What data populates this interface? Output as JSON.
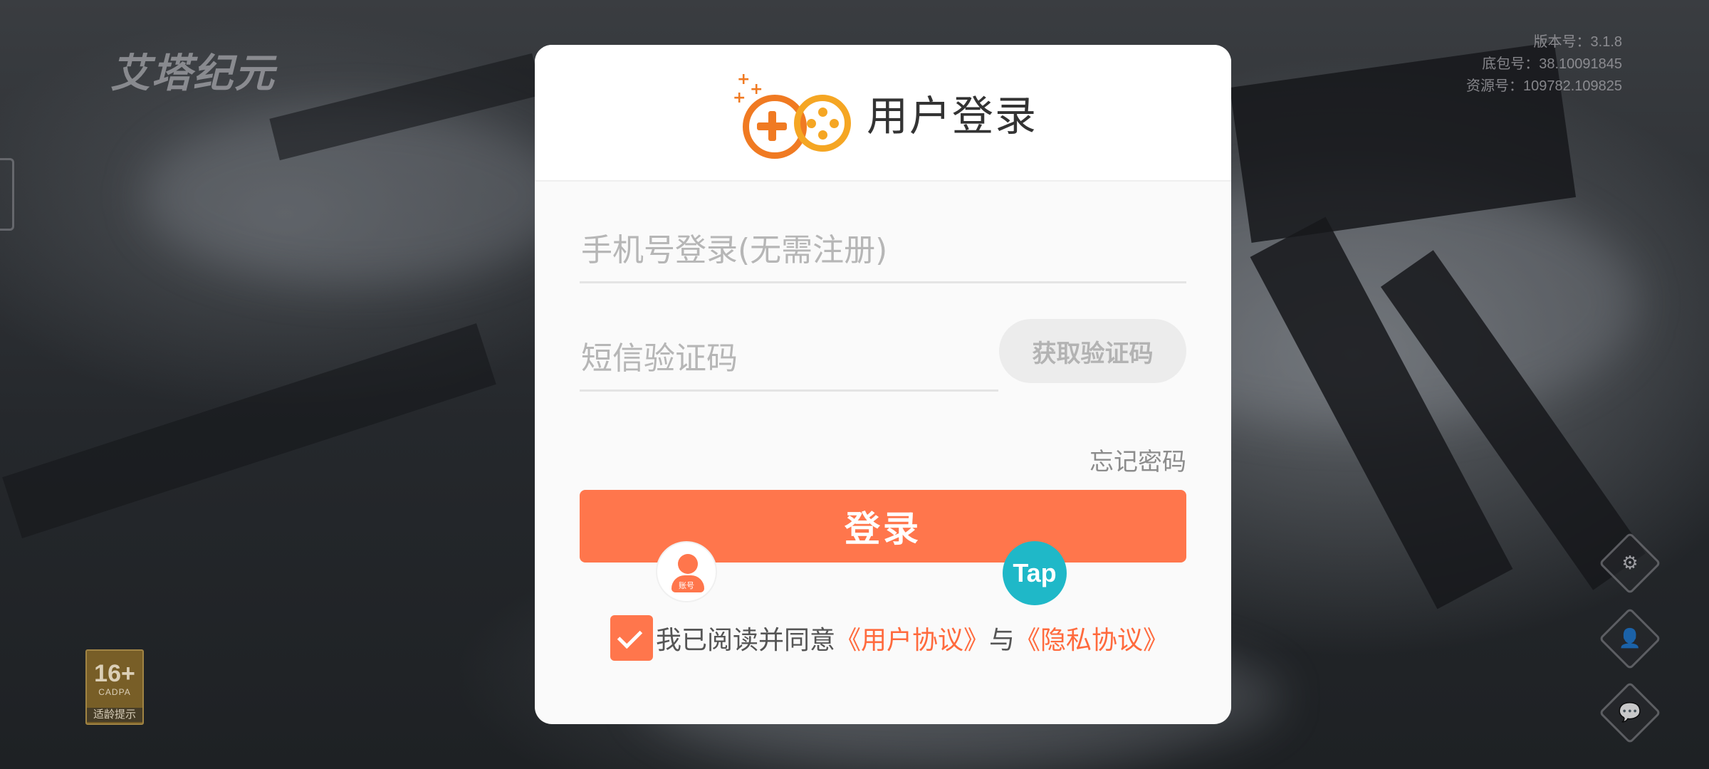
{
  "background": {
    "game_logo": "艾塔纪元",
    "version_info": [
      "版本号：3.1.8",
      "底包号：38.10091845",
      "资源号：109782.109825"
    ],
    "age_badge": {
      "rating": "16+",
      "org": "CADPA",
      "tip": "适龄提示"
    },
    "side_icons": [
      "settings-icon",
      "account-switch-icon",
      "chat-icon"
    ]
  },
  "dialog": {
    "title": "用户登录",
    "phone_placeholder": "手机号登录(无需注册)",
    "code_placeholder": "短信验证码",
    "get_code_label": "获取验证码",
    "forgot_label": "忘记密码",
    "login_label": "登录",
    "account_login_label": "账号",
    "tap_login_label": "Tap",
    "agreement": {
      "checked": true,
      "prefix": "我已阅读并同意",
      "user_agreement": "《用户协议》",
      "joiner": "与",
      "privacy_agreement": "《隐私协议》"
    }
  },
  "colors": {
    "accent": "#ff764c",
    "tap": "#1fb8c8",
    "brand_orange": "#f07a22",
    "brand_yellow": "#f5a623"
  }
}
